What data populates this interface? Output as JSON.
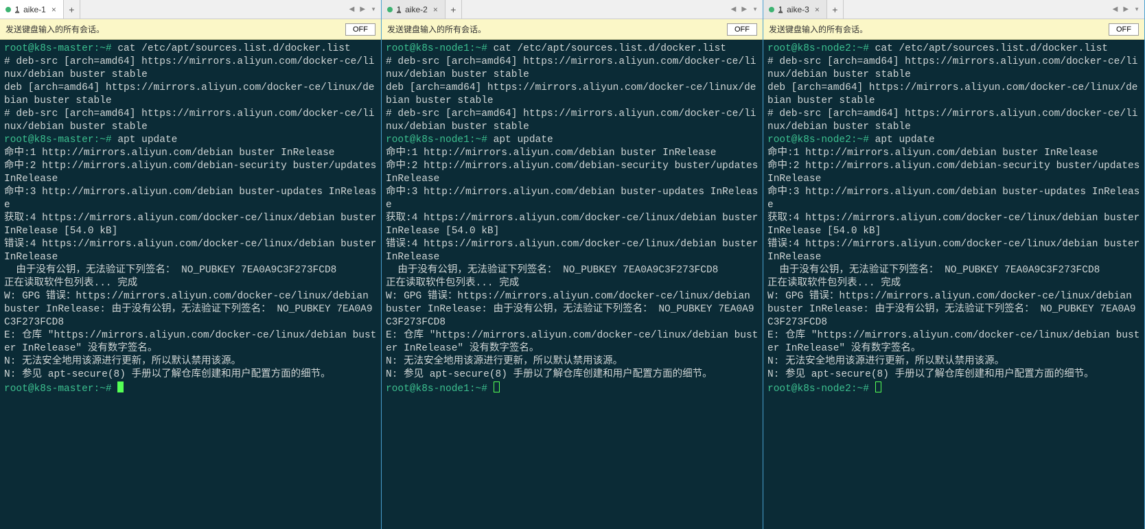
{
  "panes": [
    {
      "tab": {
        "num": "1",
        "label": "aike-1",
        "active": true,
        "close": "×"
      },
      "newtab": "+",
      "msgbar": {
        "text": "发送键盘输入的所有会话。",
        "off": "OFF"
      },
      "host": "k8s-master",
      "prompt1": "root@k8s-master:~#",
      "cmd1": "cat /etc/apt/sources.list.d/docker.list",
      "line_debsrc1": "# deb-src [arch=amd64] https://mirrors.aliyun.com/docker-ce/linux/debian buster stable",
      "line_deb": "deb [arch=amd64] https://mirrors.aliyun.com/docker-ce/linux/debian buster stable",
      "line_debsrc2": "# deb-src [arch=amd64] https://mirrors.aliyun.com/docker-ce/linux/debian buster stable",
      "prompt2": "root@k8s-master:~#",
      "cmd2": " apt update",
      "hit1": "命中:1 http://mirrors.aliyun.com/debian buster InRelease",
      "hit2": "命中:2 http://mirrors.aliyun.com/debian-security buster/updates InRelease",
      "hit3": "命中:3 http://mirrors.aliyun.com/debian buster-updates InRelease",
      "get4": "获取:4 https://mirrors.aliyun.com/docker-ce/linux/debian buster InRelease [54.0 kB]",
      "err4": "错误:4 https://mirrors.aliyun.com/docker-ce/linux/debian buster InRelease",
      "err4b": "  由于没有公钥，无法验证下列签名： NO_PUBKEY 7EA0A9C3F273FCD8",
      "reading": "正在读取软件包列表... 完成",
      "w1": "W: GPG 错误：https://mirrors.aliyun.com/docker-ce/linux/debian buster InRelease: 由于没有公钥，无法验证下列签名： NO_PUBKEY 7EA0A9C3F273FCD8",
      "e1": "E: 仓库 \"https://mirrors.aliyun.com/docker-ce/linux/debian buster InRelease\" 没有数字签名。",
      "n1": "N: 无法安全地用该源进行更新，所以默认禁用该源。",
      "n2": "N: 参见 apt-secure(8) 手册以了解仓库创建和用户配置方面的细节。",
      "prompt3": "root@k8s-master:~#",
      "cursor": "solid"
    },
    {
      "tab": {
        "num": "1",
        "label": "aike-2",
        "active": false,
        "close": "×"
      },
      "newtab": "+",
      "msgbar": {
        "text": "发送键盘输入的所有会话。",
        "off": "OFF"
      },
      "host": "k8s-node1",
      "prompt1": "root@k8s-node1:~#",
      "cmd1": "cat /etc/apt/sources.list.d/docker.list",
      "line_debsrc1": "# deb-src [arch=amd64] https://mirrors.aliyun.com/docker-ce/linux/debian buster stable",
      "line_deb": "deb [arch=amd64] https://mirrors.aliyun.com/docker-ce/linux/debian buster stable",
      "line_debsrc2": "# deb-src [arch=amd64] https://mirrors.aliyun.com/docker-ce/linux/debian buster stable",
      "prompt2": "root@k8s-node1:~#",
      "cmd2": " apt update",
      "hit1": "命中:1 http://mirrors.aliyun.com/debian buster InRelease",
      "hit2": "命中:2 http://mirrors.aliyun.com/debian-security buster/updates InRelease",
      "hit3": "命中:3 http://mirrors.aliyun.com/debian buster-updates InRelease",
      "get4": "获取:4 https://mirrors.aliyun.com/docker-ce/linux/debian buster InRelease [54.0 kB]",
      "err4": "错误:4 https://mirrors.aliyun.com/docker-ce/linux/debian buster InRelease",
      "err4b": "  由于没有公钥，无法验证下列签名： NO_PUBKEY 7EA0A9C3F273FCD8",
      "reading": "正在读取软件包列表... 完成",
      "w1": "W: GPG 错误：https://mirrors.aliyun.com/docker-ce/linux/debian buster InRelease: 由于没有公钥，无法验证下列签名： NO_PUBKEY 7EA0A9C3F273FCD8",
      "e1": "E: 仓库 \"https://mirrors.aliyun.com/docker-ce/linux/debian buster InRelease\" 没有数字签名。",
      "n1": "N: 无法安全地用该源进行更新，所以默认禁用该源。",
      "n2": "N: 参见 apt-secure(8) 手册以了解仓库创建和用户配置方面的细节。",
      "prompt3": "root@k8s-node1:~#",
      "cursor": "outline"
    },
    {
      "tab": {
        "num": "1",
        "label": "aike-3",
        "active": false,
        "close": "×"
      },
      "newtab": "+",
      "msgbar": {
        "text": "发送键盘输入的所有会话。",
        "off": "OFF"
      },
      "host": "k8s-node2",
      "prompt1": "root@k8s-node2:~#",
      "cmd1": "cat /etc/apt/sources.list.d/docker.list",
      "line_debsrc1": "# deb-src [arch=amd64] https://mirrors.aliyun.com/docker-ce/linux/debian buster stable",
      "line_deb": "deb [arch=amd64] https://mirrors.aliyun.com/docker-ce/linux/debian buster stable",
      "line_debsrc2": "# deb-src [arch=amd64] https://mirrors.aliyun.com/docker-ce/linux/debian buster stable",
      "prompt2": "root@k8s-node2:~#",
      "cmd2": " apt update",
      "hit1": "命中:1 http://mirrors.aliyun.com/debian buster InRelease",
      "hit2": "命中:2 http://mirrors.aliyun.com/debian-security buster/updates InRelease",
      "hit3": "命中:3 http://mirrors.aliyun.com/debian buster-updates InRelease",
      "get4": "获取:4 https://mirrors.aliyun.com/docker-ce/linux/debian buster InRelease [54.0 kB]",
      "err4": "错误:4 https://mirrors.aliyun.com/docker-ce/linux/debian buster InRelease",
      "err4b": "  由于没有公钥，无法验证下列签名： NO_PUBKEY 7EA0A9C3F273FCD8",
      "reading": "正在读取软件包列表... 完成",
      "w1": "W: GPG 错误：https://mirrors.aliyun.com/docker-ce/linux/debian buster InRelease: 由于没有公钥，无法验证下列签名： NO_PUBKEY 7EA0A9C3F273FCD8",
      "e1": "E: 仓库 \"https://mirrors.aliyun.com/docker-ce/linux/debian buster InRelease\" 没有数字签名。",
      "n1": "N: 无法安全地用该源进行更新，所以默认禁用该源。",
      "n2": "N: 参见 apt-secure(8) 手册以了解仓库创建和用户配置方面的细节。",
      "prompt3": "root@k8s-node2:~#",
      "cursor": "outline"
    }
  ],
  "navsymbols": {
    "prev": "◀",
    "next": "▶",
    "drop": "▼"
  }
}
